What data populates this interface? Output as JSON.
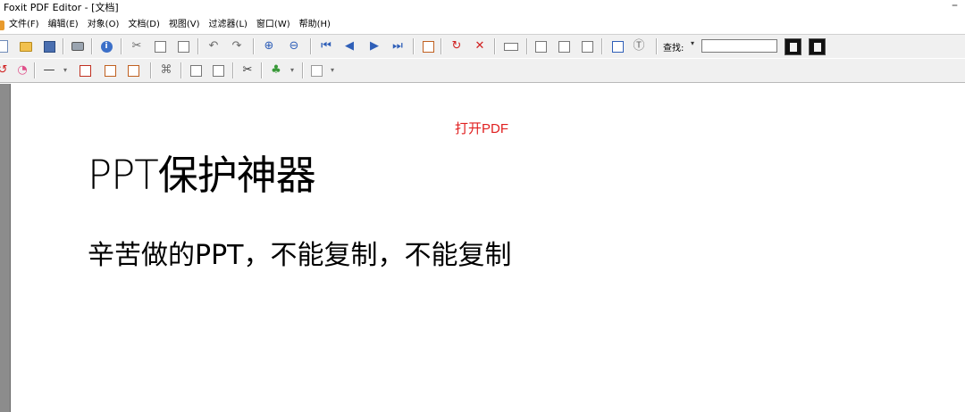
{
  "window": {
    "title": "Foxit PDF Editor - [文档]",
    "minimize_glyph": "–"
  },
  "menubar": {
    "items": [
      "文件(F)",
      "编辑(E)",
      "对象(O)",
      "文档(D)",
      "视图(V)",
      "过滤器(L)",
      "窗口(W)",
      "帮助(H)"
    ]
  },
  "toolbar": {
    "search_label": "查找:",
    "search_value": "",
    "icons_row1": [
      "new-document-icon",
      "open-folder-icon",
      "save-icon",
      "print-icon",
      "info-icon",
      "cut-icon",
      "copy-icon",
      "paste-icon",
      "undo-icon",
      "redo-icon",
      "zoom-in-icon",
      "zoom-out-icon",
      "first-page-icon",
      "previous-page-icon",
      "next-page-icon",
      "last-page-icon",
      "page-properties-icon",
      "rotate-page-icon",
      "delete-page-icon",
      "ruler-icon",
      "text-tool-icon",
      "column-tool-icon",
      "grid-tool-icon",
      "bookmark-icon",
      "font-icon"
    ],
    "icons_row2": [
      "circle-arrow-icon",
      "color-icon",
      "line-tool-icon",
      "object-icon",
      "edit-image-icon",
      "edit-page-icon",
      "crop-icon",
      "align-left-icon",
      "align-right-icon",
      "scissor-icon",
      "color-fill-icon",
      "layout-icon"
    ]
  },
  "document": {
    "open_link": "打开PDF",
    "title": "PPT保护神器",
    "subtitle": "辛苦做的PPT，不能复制，不能复制"
  },
  "colors": {
    "open_link": "#e02020",
    "toolbar_bg": "#f0f0f0",
    "sidebar": "#8c8c8c"
  }
}
